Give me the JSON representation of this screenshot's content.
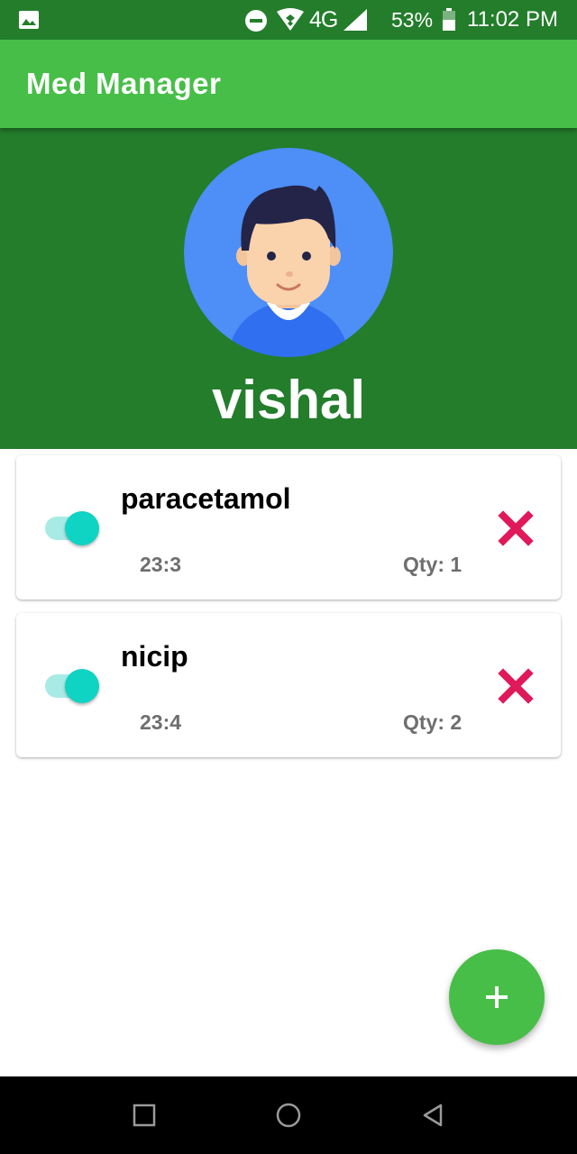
{
  "status_bar": {
    "network": "4G",
    "battery_percent": "53%",
    "time": "11:02 PM",
    "icons": [
      "image-icon",
      "do-not-disturb-icon",
      "wifi-icon",
      "signal-icon",
      "battery-icon"
    ]
  },
  "app_bar": {
    "title": "Med Manager"
  },
  "profile": {
    "avatar_icon": "user-avatar",
    "name": "vishal"
  },
  "medicines": [
    {
      "name": "paracetamol",
      "time": "23:3",
      "qty": "Qty: 1",
      "enabled": true
    },
    {
      "name": "nicip",
      "time": "23:4",
      "qty": "Qty: 2",
      "enabled": true
    }
  ],
  "fab": {
    "icon": "plus-icon"
  },
  "nav_bar": {
    "icons": [
      "recent-apps-icon",
      "home-icon",
      "back-icon"
    ]
  },
  "colors": {
    "primary": "#47be47",
    "primary_dark": "#237d2b",
    "switch_accent": "#0fd3c3",
    "delete": "#e0195a"
  }
}
